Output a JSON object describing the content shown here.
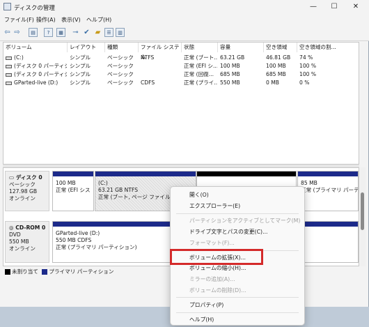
{
  "window": {
    "title": "ディスクの管理",
    "caption": {
      "minimize": "—",
      "maximize": "☐",
      "close": "✕"
    }
  },
  "menu": [
    "ファイル(F)",
    "操作(A)",
    "表示(V)",
    "ヘルプ(H)"
  ],
  "toolbar_icons": [
    "back-arrow-icon",
    "forward-arrow-icon",
    "console-icon",
    "help-icon",
    "properties-icon",
    "connect-icon",
    "check-icon",
    "new-folder-icon",
    "view-icon"
  ],
  "volume_list": {
    "columns": [
      "ボリューム",
      "レイアウト",
      "種類",
      "ファイル システム",
      "状態",
      "容量",
      "空き領域",
      "空き領域の割..."
    ],
    "rows": [
      [
        "(C:)",
        "シンプル",
        "ベーシック",
        "NTFS",
        "正常 (ブート...",
        "63.21 GB",
        "46.81 GB",
        "74 %"
      ],
      [
        "(ディスク 0 パーティショ...",
        "シンプル",
        "ベーシック",
        "",
        "正常 (EFI シ...",
        "100 MB",
        "100 MB",
        "100 %"
      ],
      [
        "(ディスク 0 パーティショ...",
        "シンプル",
        "ベーシック",
        "",
        "正常 (回復...",
        "685 MB",
        "685 MB",
        "100 %"
      ],
      [
        "GParted-live (D:)",
        "シンプル",
        "ベーシック",
        "CDFS",
        "正常 (プライ...",
        "550 MB",
        "0 MB",
        "0 %"
      ]
    ]
  },
  "disks": {
    "disk0": {
      "name": "ディスク 0",
      "type": "ベーシック",
      "size": "127.98 GB",
      "status": "オンライン",
      "partitions": {
        "efi": {
          "size": "100 MB",
          "status": "正常 (EFI シス"
        },
        "c": {
          "name": "(C:)",
          "size": "63.21 GB NTFS",
          "status": "正常 (ブート, ページ ファイル, クラッ"
        },
        "recovery": {
          "size": "85 MB",
          "status": "正常 (プライマリ パーティショ"
        }
      }
    },
    "cdrom0": {
      "name": "CD-ROM 0",
      "type": "DVD",
      "size": "550 MB",
      "status": "オンライン",
      "partition": {
        "name": "GParted-live (D:)",
        "size": "550 MB CDFS",
        "status": "正常 (プライマリ パーティション)"
      }
    }
  },
  "legend": {
    "unallocated": "未割り当て",
    "primary": "プライマリ パーティション",
    "unallocated_color": "#000000",
    "primary_color": "#1c2a8a"
  },
  "context_menu": {
    "items": [
      {
        "label": "開く(O)",
        "enabled": true
      },
      {
        "label": "エクスプローラー(E)",
        "enabled": true
      },
      {
        "label": "パーティションをアクティブとしてマーク(M)",
        "enabled": false
      },
      {
        "label": "ドライブ文字とパスの変更(C)...",
        "enabled": true
      },
      {
        "label": "フォーマット(F)...",
        "enabled": false
      },
      {
        "label": "ボリュームの拡張(X)...",
        "enabled": true
      },
      {
        "label": "ボリュームの縮小(H)...",
        "enabled": true
      },
      {
        "label": "ミラーの追加(A)...",
        "enabled": false
      },
      {
        "label": "ボリュームの削除(D)...",
        "enabled": false
      },
      {
        "label": "プロパティ(P)",
        "enabled": true
      },
      {
        "label": "ヘルプ(H)",
        "enabled": true
      }
    ],
    "highlight_color": "#d42a2a"
  }
}
